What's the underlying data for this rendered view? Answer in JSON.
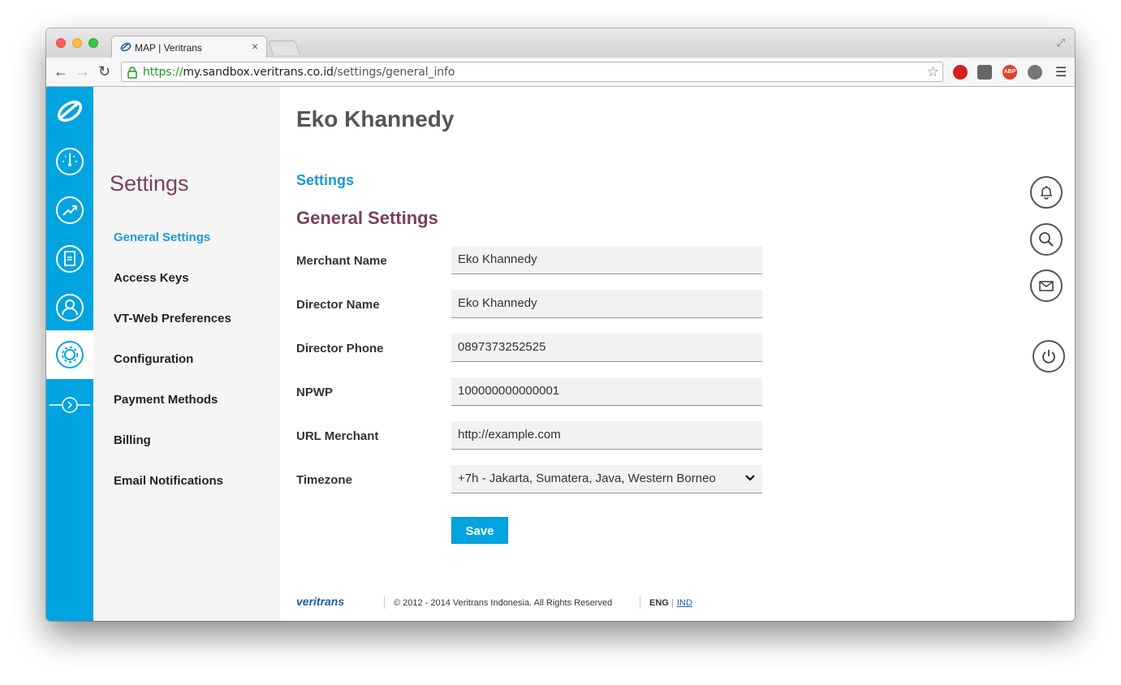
{
  "browser": {
    "tab_title": "MAP | Veritrans",
    "tab_close": "×",
    "url_scheme": "https://",
    "url_host": "my.sandbox.veritrans.co.id",
    "url_path": "/settings/general_info",
    "ext_abp": "ABP"
  },
  "header": {
    "user_name": "Eko Khannedy"
  },
  "sidebar": {
    "title": "Settings",
    "items": [
      {
        "label": "General Settings",
        "active": true
      },
      {
        "label": "Access Keys"
      },
      {
        "label": "VT-Web Preferences"
      },
      {
        "label": "Configuration"
      },
      {
        "label": "Payment Methods"
      },
      {
        "label": "Billing"
      },
      {
        "label": "Email Notifications"
      }
    ]
  },
  "rail": {
    "icons": [
      "veritrans-logo-icon",
      "dashboard-gauge-icon",
      "transactions-chart-icon",
      "report-document-icon",
      "user-profile-icon",
      "settings-gear-icon",
      "expand-arrow-icon"
    ],
    "active_index": 5
  },
  "main": {
    "breadcrumb": "Settings",
    "section_title": "General Settings",
    "fields": [
      {
        "label": "Merchant Name",
        "value": "Eko Khannedy"
      },
      {
        "label": "Director Name",
        "value": "Eko Khannedy"
      },
      {
        "label": "Director Phone",
        "value": "0897373252525"
      },
      {
        "label": "NPWP",
        "value": "100000000000001"
      },
      {
        "label": "URL Merchant",
        "value": "http://example.com"
      },
      {
        "label": "Timezone",
        "value": "+7h - Jakarta, Sumatera, Java, Western Borneo"
      }
    ],
    "save_label": "Save"
  },
  "footer": {
    "logo": "veritrans",
    "copyright": "© 2012 - 2014 Veritrans Indonesia. All Rights Reserved",
    "lang_eng": "ENG",
    "lang_sep": "|",
    "lang_ind": "IND"
  },
  "right_actions": [
    "bell-icon",
    "search-icon",
    "mail-icon",
    "power-icon"
  ],
  "colors": {
    "brand_blue": "#00a4e0",
    "heading_purple": "#7b3f5f",
    "link_blue": "#1b9ad6"
  }
}
